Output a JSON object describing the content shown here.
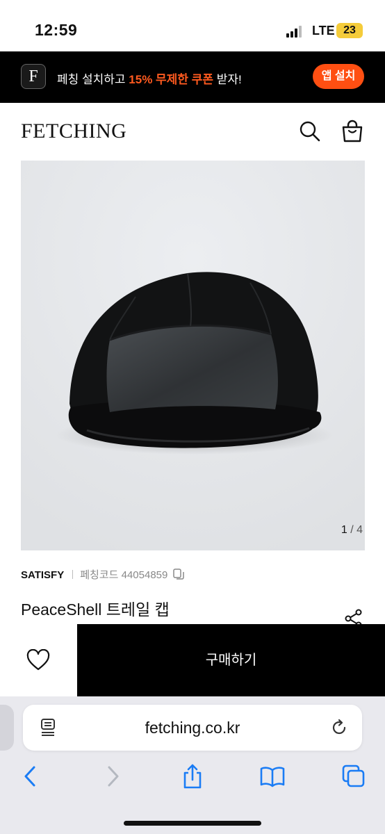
{
  "status_bar": {
    "time": "12:59",
    "network": "LTE",
    "battery": "23"
  },
  "banner": {
    "logo_letter": "F",
    "message_prefix": "페칭 설치하고 ",
    "message_highlight": "15% 무제한 쿠폰",
    "message_suffix": " 받자!",
    "install_button": "앱 설치",
    "accent_color": "#ff4f12"
  },
  "header": {
    "brand": "FETCHING",
    "icons": [
      "search-icon",
      "shopping-bag-icon"
    ]
  },
  "product": {
    "image_counter_current": "1",
    "image_counter_sep": " / ",
    "image_counter_total": "4",
    "brand": "SATISFY",
    "code_label": "페칭코드",
    "code": "44054859",
    "title": "PeaceShell 트레일 캡"
  },
  "purchase_bar": {
    "buy_label": "구매하기"
  },
  "browser": {
    "url": "fetching.co.kr"
  }
}
